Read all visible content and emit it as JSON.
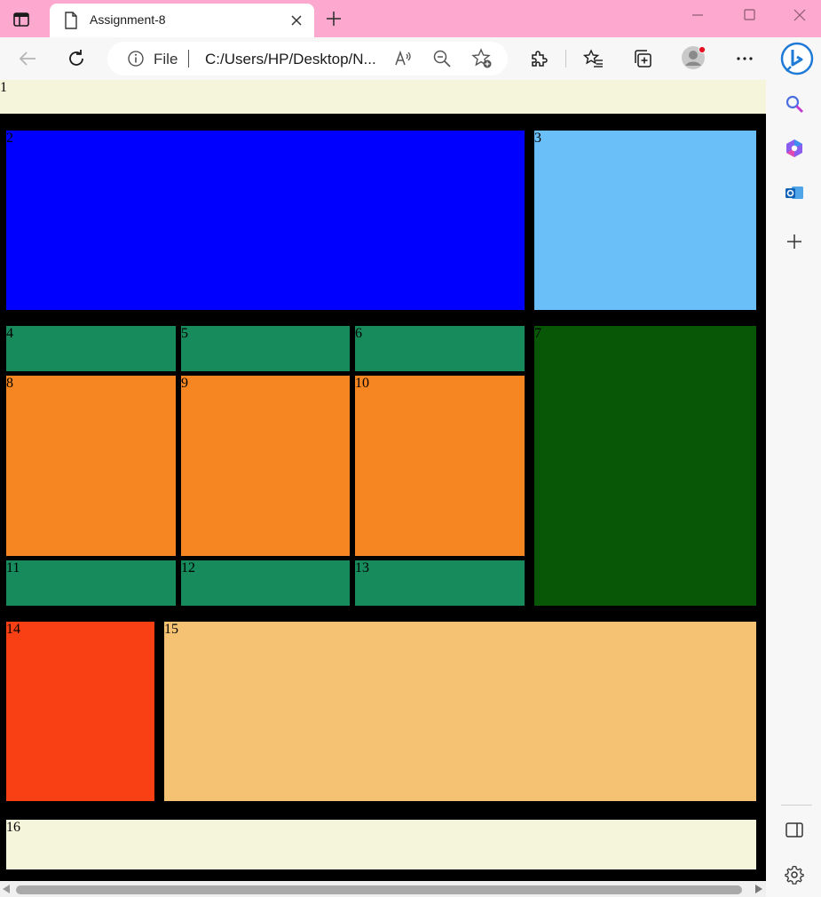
{
  "browser": {
    "tab_title": "Assignment-8",
    "address_scheme": "File",
    "address_url": "C:/Users/HP/Desktop/N...",
    "colors": {
      "titlebar": "#fca8cf",
      "toolbar": "#f7f7f7",
      "profile_badge": "#e81123"
    },
    "icons": {
      "sidebar_toggle": "sidebar-toggle-icon",
      "tab_page": "document-icon",
      "tab_close": "close-icon",
      "new_tab": "plus-icon",
      "back": "arrow-left-icon",
      "refresh": "refresh-icon",
      "info": "info-icon",
      "read_aloud": "read-aloud-icon",
      "zoom_out": "zoom-out-icon",
      "add_favorite": "star-add-icon",
      "extensions": "puzzle-icon",
      "favorites": "favorites-icon",
      "collections": "collections-icon",
      "profile": "avatar-icon",
      "more": "ellipsis-icon",
      "bing": "bing-icon",
      "search": "search-icon",
      "copilot": "copilot-icon",
      "outlook": "outlook-icon",
      "add_sidebar_app": "plus-icon",
      "hide_sidebar": "sidebar-panel-icon",
      "settings": "gear-icon"
    }
  },
  "page": {
    "boxes": [
      {
        "label": "1",
        "color": "#f5f5dc"
      },
      {
        "label": "2",
        "color": "#0000ff"
      },
      {
        "label": "3",
        "color": "#6abff8"
      },
      {
        "label": "4",
        "color": "#178b5c"
      },
      {
        "label": "5",
        "color": "#178b5c"
      },
      {
        "label": "6",
        "color": "#178b5c"
      },
      {
        "label": "7",
        "color": "#075707"
      },
      {
        "label": "8",
        "color": "#f58621"
      },
      {
        "label": "9",
        "color": "#f58621"
      },
      {
        "label": "10",
        "color": "#f58621"
      },
      {
        "label": "11",
        "color": "#178b5c"
      },
      {
        "label": "12",
        "color": "#178b5c"
      },
      {
        "label": "13",
        "color": "#178b5c"
      },
      {
        "label": "14",
        "color": "#f84014"
      },
      {
        "label": "15",
        "color": "#f5c173"
      },
      {
        "label": "16",
        "color": "#f5f5dc"
      }
    ]
  }
}
